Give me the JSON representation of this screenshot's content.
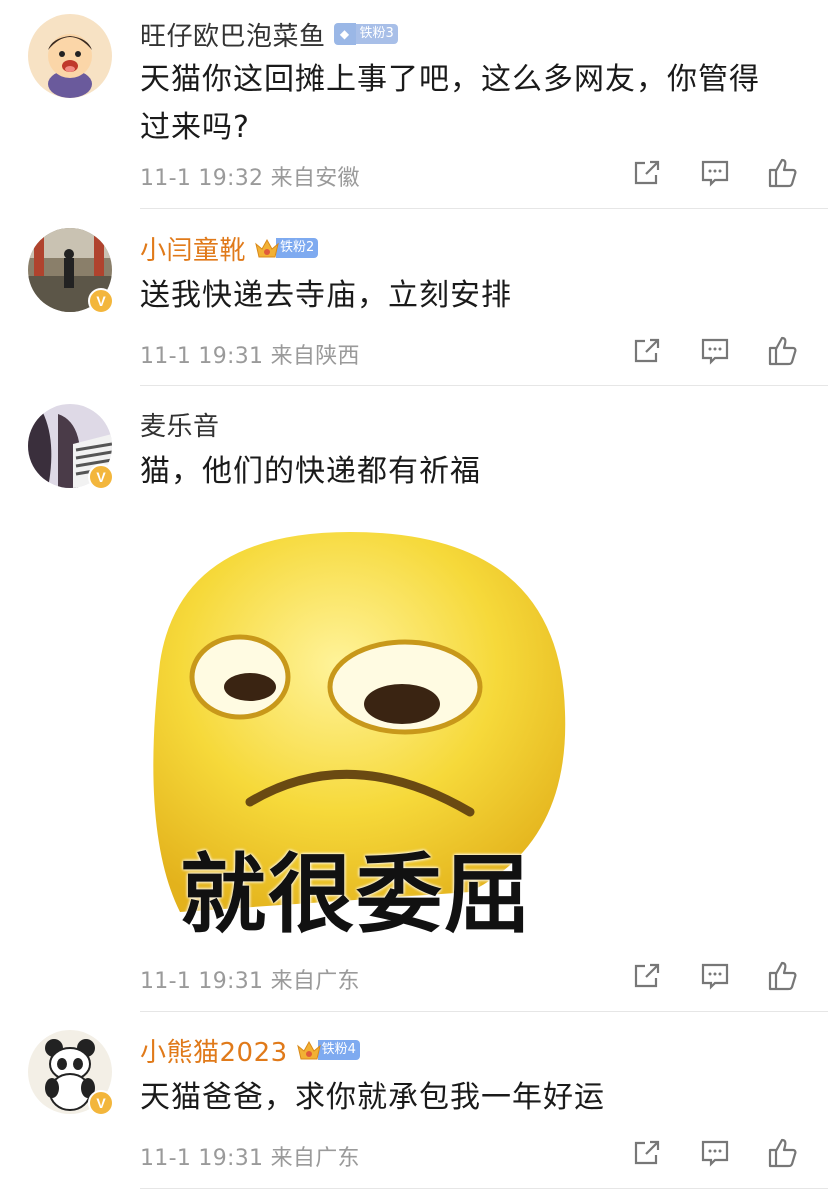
{
  "comments": [
    {
      "name": "旺仔欧巴泡菜鱼",
      "badge": "铁粉3",
      "text": "天猫你这回摊上事了吧，这么多网友，你管得过来吗?",
      "time": "11-1 19:32",
      "location": "来自安徽",
      "verified": false
    },
    {
      "name": "小闫童靴",
      "badge": "铁粉2",
      "text": "送我快递去寺庙，立刻安排",
      "time": "11-1 19:31",
      "location": "来自陕西",
      "verified": true
    },
    {
      "name": "麦乐音",
      "text": "猫，他们的快递都有祈福",
      "time": "11-1 19:31",
      "location": "来自广东",
      "verified": true,
      "meme_caption": "就很委屈"
    },
    {
      "name": "小熊猫2023",
      "badge": "铁粉4",
      "text": "天猫爸爸，求你就承包我一年好运",
      "time": "11-1 19:31",
      "location": "来自广东",
      "verified": true
    }
  ],
  "verified_mark": "V",
  "colors": {
    "vip_name": "#e07a1a",
    "badge_blue": "#7eaaf0",
    "verified_gold": "#f3b63c",
    "meta_gray": "#9a9a9a"
  },
  "icons": [
    "share-icon",
    "comment-icon",
    "like-icon"
  ]
}
